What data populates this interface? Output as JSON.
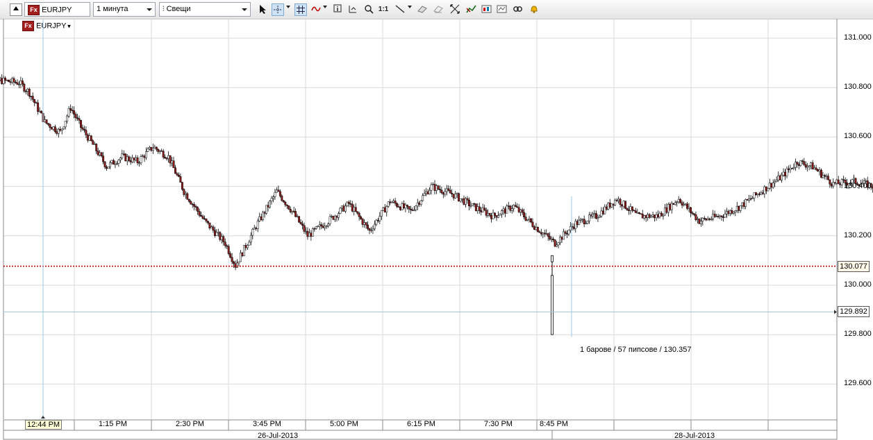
{
  "toolbar": {
    "symbol": "EURJPY",
    "timeframe": "1 минута",
    "charttype": "Свещи",
    "fx_badge": "Fx",
    "zoom_1to1": "1:1"
  },
  "symbol_label": "EURJPY",
  "crosshair_time": "12:44 PM",
  "measure_text": "1 барове / 57 пипсове / 130.357",
  "chart_data": {
    "type": "candlestick",
    "symbol": "EURJPY",
    "ylim": [
      129.43,
      131.1
    ],
    "yticks": [
      "131.000",
      "130.800",
      "130.600",
      "130.400",
      "130.200",
      "130.000",
      "129.800",
      "129.600"
    ],
    "xticks": [
      "12:44 PM",
      "1:15 PM",
      "2:30 PM",
      "3:45 PM",
      "5:00 PM",
      "6:15 PM",
      "7:30 PM",
      "8:45 PM"
    ],
    "dates": [
      "26-Jul-2013",
      "28-Jul-2013"
    ],
    "current_price": "130.077",
    "cursor_price": "129.892",
    "close_path": [
      [
        12.1,
        130.84
      ],
      [
        12.3,
        130.83
      ],
      [
        12.5,
        130.82
      ],
      [
        12.6,
        130.78
      ],
      [
        12.75,
        130.66
      ],
      [
        12.9,
        130.62
      ],
      [
        13.0,
        130.72
      ],
      [
        13.1,
        130.64
      ],
      [
        13.2,
        130.58
      ],
      [
        13.35,
        130.48
      ],
      [
        13.5,
        130.52
      ],
      [
        13.65,
        130.5
      ],
      [
        13.8,
        130.56
      ],
      [
        13.95,
        130.52
      ],
      [
        14.1,
        130.38
      ],
      [
        14.3,
        130.26
      ],
      [
        14.5,
        130.17
      ],
      [
        14.6,
        130.08
      ],
      [
        14.8,
        130.24
      ],
      [
        15.0,
        130.38
      ],
      [
        15.15,
        130.3
      ],
      [
        15.3,
        130.2
      ],
      [
        15.5,
        130.26
      ],
      [
        15.7,
        130.33
      ],
      [
        15.9,
        130.22
      ],
      [
        16.1,
        130.34
      ],
      [
        16.3,
        130.3
      ],
      [
        16.5,
        130.4
      ],
      [
        16.7,
        130.37
      ],
      [
        16.9,
        130.32
      ],
      [
        17.1,
        130.28
      ],
      [
        17.3,
        130.32
      ],
      [
        17.5,
        130.24
      ],
      [
        17.7,
        130.17
      ],
      [
        17.9,
        130.25
      ],
      [
        18.1,
        130.28
      ],
      [
        18.3,
        130.35
      ],
      [
        18.5,
        130.28
      ],
      [
        18.7,
        130.28
      ],
      [
        18.9,
        130.35
      ],
      [
        19.1,
        130.26
      ],
      [
        19.3,
        130.28
      ],
      [
        19.5,
        130.32
      ],
      [
        19.7,
        130.38
      ],
      [
        19.9,
        130.44
      ],
      [
        20.05,
        130.5
      ],
      [
        20.2,
        130.48
      ],
      [
        20.4,
        130.41
      ],
      [
        20.6,
        130.42
      ],
      [
        20.8,
        130.4
      ],
      [
        21.0,
        130.42
      ],
      [
        21.2,
        130.36
      ],
      [
        21.35,
        130.4
      ],
      [
        21.5,
        130.43
      ],
      [
        21.6,
        130.52
      ],
      [
        21.7,
        130.38
      ],
      [
        21.75,
        130.27
      ]
    ],
    "last_candle": {
      "time": "20:50",
      "open": 130.095,
      "high": 130.12,
      "low": 129.8,
      "close": 130.077
    }
  },
  "colors": {
    "bull_candle": "#ffffff",
    "bear_candle": "#8b1a1a",
    "grid": "#d9d9d9",
    "current_price_line": "#c00000",
    "crosshair": "#9cc9e6"
  }
}
